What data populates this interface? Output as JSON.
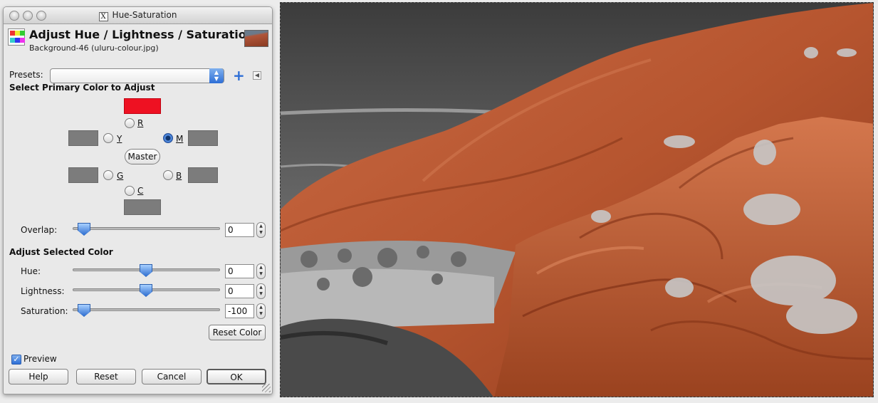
{
  "window": {
    "title": "Hue-Saturation",
    "title_icon": "x11-icon"
  },
  "header": {
    "title": "Adjust Hue / Lightness / Saturation",
    "subtitle": "Background-46 (uluru-colour.jpg)"
  },
  "presets": {
    "label": "Presets:",
    "value": ""
  },
  "primary": {
    "section_label": "Select Primary Color to Adjust",
    "colors": {
      "R": "#ee1122",
      "others": "#7c7c7c"
    },
    "options": [
      {
        "key": "R",
        "label": "R",
        "selected": false
      },
      {
        "key": "Y",
        "label": "Y",
        "selected": false
      },
      {
        "key": "M",
        "label": "M",
        "selected": true
      },
      {
        "key": "G",
        "label": "G",
        "selected": false
      },
      {
        "key": "B",
        "label": "B",
        "selected": false
      },
      {
        "key": "C",
        "label": "C",
        "selected": false
      }
    ],
    "master_label": "Master"
  },
  "overlap": {
    "label": "Overlap:",
    "value": "0"
  },
  "adjust": {
    "section_label": "Adjust Selected Color",
    "hue": {
      "label": "Hue:",
      "value": "0"
    },
    "lightness": {
      "label": "Lightness:",
      "value": "0"
    },
    "saturation": {
      "label": "Saturation:",
      "value": "-100"
    },
    "reset_color_label": "Reset Color"
  },
  "preview": {
    "label": "Preview",
    "checked": true
  },
  "buttons": {
    "help": "Help",
    "reset": "Reset",
    "cancel": "Cancel",
    "ok": "OK"
  }
}
